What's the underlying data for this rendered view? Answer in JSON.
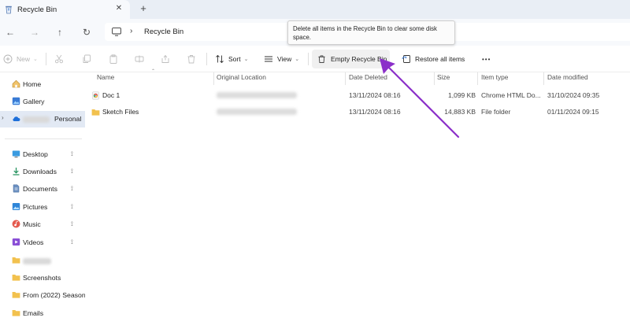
{
  "window": {
    "tab_title": "Recycle Bin",
    "close_glyph": "✕",
    "new_tab_glyph": "+"
  },
  "address": {
    "path": "Recycle Bin",
    "separator": "›"
  },
  "nav": {
    "back": "←",
    "forward": "→",
    "up": "↑",
    "refresh": "↻"
  },
  "tooltip": {
    "text": "Delete all items in the Recycle Bin to clear some disk space."
  },
  "toolbar": {
    "new_label": "New",
    "sort_label": "Sort",
    "view_label": "View",
    "empty_label": "Empty Recycle Bin",
    "restore_label": "Restore all items",
    "more_label": "•••",
    "caret": "⌄"
  },
  "sidebar": {
    "home": "Home",
    "gallery": "Gallery",
    "personal": "Personal",
    "desktop": "Desktop",
    "downloads": "Downloads",
    "documents": "Documents",
    "pictures": "Pictures",
    "music": "Music",
    "videos": "Videos",
    "screenshots": "Screenshots",
    "from_folder": "From (2022) Season",
    "emails": "Emails",
    "pin_glyph": "📌",
    "expander": "›"
  },
  "columns": {
    "name": "Name",
    "original_location": "Original Location",
    "date_deleted": "Date Deleted",
    "size": "Size",
    "item_type": "Item type",
    "date_modified": "Date modified"
  },
  "files": [
    {
      "name": "Doc 1",
      "date_deleted": "13/11/2024 08:16",
      "size": "1,099 KB",
      "item_type": "Chrome HTML Do...",
      "date_modified": "31/10/2024 09:35"
    },
    {
      "name": "Sketch Files",
      "date_deleted": "13/11/2024 08:16",
      "size": "14,883 KB",
      "item_type": "File folder",
      "date_modified": "01/11/2024 09:15"
    }
  ],
  "colors": {
    "accent_arrow": "#8b2fc9",
    "folder": "#f2c14e",
    "selection": "#e2e9f4"
  }
}
